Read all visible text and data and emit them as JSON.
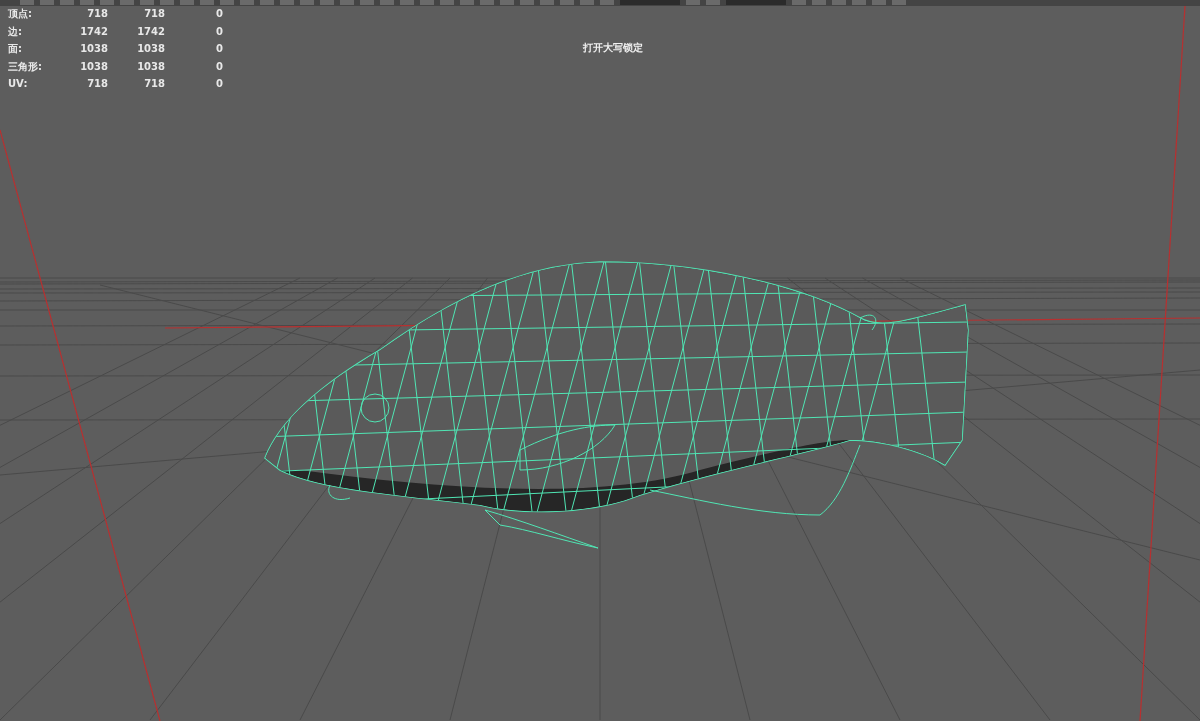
{
  "hud": {
    "rows": [
      {
        "label": "顶点:",
        "values": [
          "718",
          "718",
          "0"
        ]
      },
      {
        "label": "边:",
        "values": [
          "1742",
          "1742",
          "0"
        ]
      },
      {
        "label": "面:",
        "values": [
          "1038",
          "1038",
          "0"
        ]
      },
      {
        "label": "三角形:",
        "values": [
          "1038",
          "1038",
          "0"
        ]
      },
      {
        "label": "UV:",
        "values": [
          "718",
          "718",
          "0"
        ]
      }
    ]
  },
  "message": "打开大写锁定"
}
